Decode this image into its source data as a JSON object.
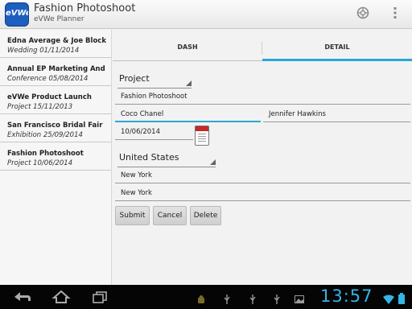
{
  "app": {
    "logo_text": "eVWe",
    "title": "Fashion Photoshoot",
    "subtitle": "eVWe Planner",
    "accent_color": "#2aa7d6",
    "icons": [
      "help-icon",
      "overflow-menu-icon"
    ]
  },
  "events": [
    {
      "title": "Edna Average & Joe Block",
      "sub": "Wedding 01/11/2014"
    },
    {
      "title": "Annual EP Marketing And",
      "sub": "Conference 05/08/2014"
    },
    {
      "title": "eVWe Product Launch",
      "sub": "Project 15/11/2013"
    },
    {
      "title": "San Francisco Bridal Fair",
      "sub": "Exhibition 25/09/2014"
    },
    {
      "title": "Fashion Photoshoot",
      "sub": "Project 10/06/2014"
    }
  ],
  "tabs": {
    "dash": "DASH",
    "detail": "DETAIL"
  },
  "form": {
    "type_select": "Project",
    "event_name": "Fashion Photoshoot",
    "person1": "Coco Chanel",
    "person2": "Jennifer Hawkins",
    "date": "10/06/2014",
    "country_select": "United States",
    "state": "New York",
    "city": "New York"
  },
  "buttons": {
    "submit": "Submit",
    "cancel": "Cancel",
    "delete": "Delete"
  },
  "statusbar": {
    "clock": "13:57"
  }
}
